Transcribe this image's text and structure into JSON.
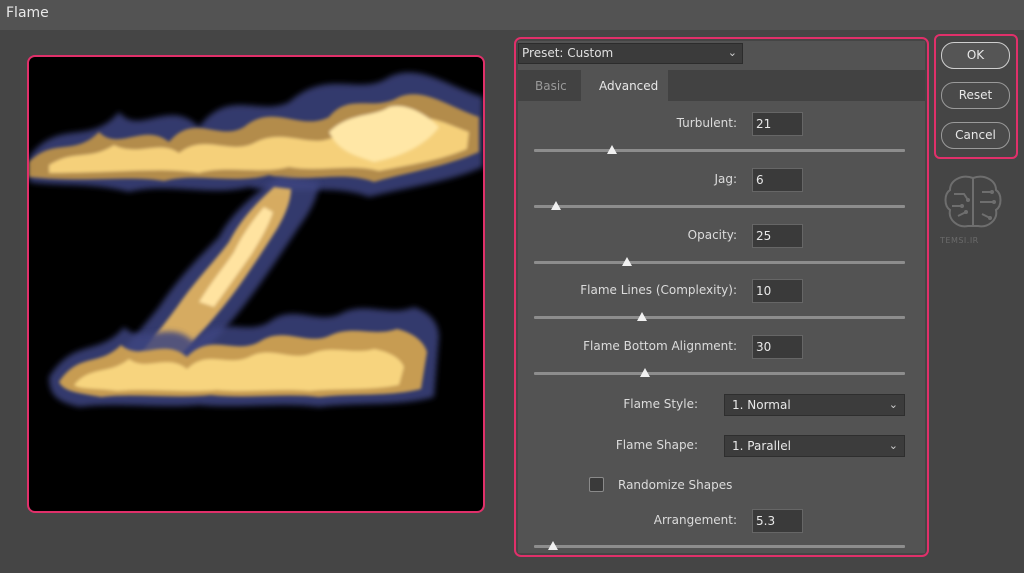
{
  "window": {
    "title": "Flame"
  },
  "preset": {
    "label": "Preset: Custom"
  },
  "tabs": [
    {
      "label": "Basic"
    },
    {
      "label": "Advanced"
    }
  ],
  "fields": {
    "turbulent": {
      "label": "Turbulent:",
      "value": "21",
      "level": 0.21
    },
    "jag": {
      "label": "Jag:",
      "value": "6",
      "level": 0.06
    },
    "opacity": {
      "label": "Opacity:",
      "value": "25",
      "level": 0.25
    },
    "flame_lines": {
      "label": "Flame Lines (Complexity):",
      "value": "10",
      "level": 0.29
    },
    "bottom_alignment": {
      "label": "Flame Bottom Alignment:",
      "value": "30",
      "level": 0.3
    },
    "arrangement": {
      "label": "Arrangement:",
      "value": "5.3",
      "level": 0.05
    }
  },
  "flame_style": {
    "label": "Flame Style:",
    "value": "1. Normal"
  },
  "flame_shape": {
    "label": "Flame Shape:",
    "value": "1. Parallel"
  },
  "randomize": {
    "label": "Randomize Shapes",
    "checked": false
  },
  "buttons": {
    "ok": "OK",
    "reset": "Reset",
    "cancel": "Cancel"
  },
  "watermark": {
    "text": "TEMSI.IR"
  },
  "colors": {
    "accent": "#e0306a",
    "flame_core": "#f5c862",
    "flame_edge": "#4a4f8a"
  }
}
